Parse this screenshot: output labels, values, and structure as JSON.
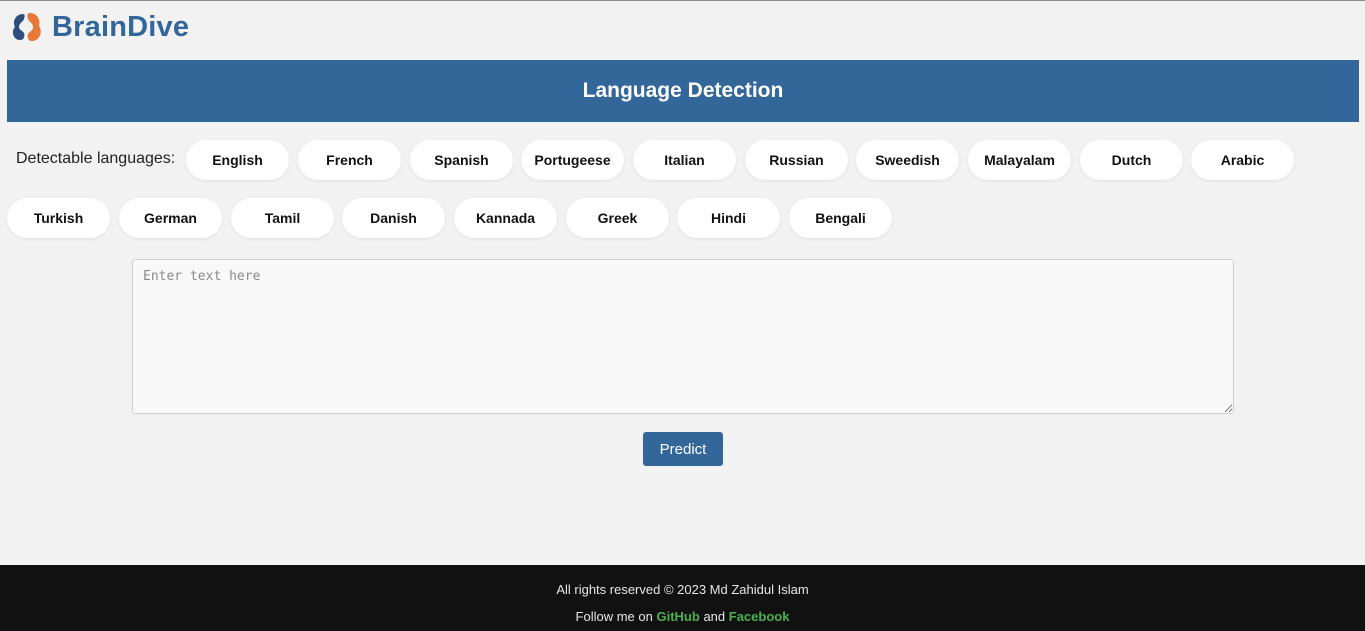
{
  "brand": {
    "name": "BrainDive",
    "colors": {
      "primary": "#336699",
      "accent": "#e8773a"
    }
  },
  "banner": {
    "title": "Language Detection"
  },
  "languages": {
    "label": "Detectable languages:",
    "row1": [
      "English",
      "French",
      "Spanish",
      "Portugeese",
      "Italian",
      "Russian",
      "Sweedish",
      "Malayalam",
      "Dutch",
      "Arabic"
    ],
    "row2": [
      "Turkish",
      "German",
      "Tamil",
      "Danish",
      "Kannada",
      "Greek",
      "Hindi",
      "Bengali"
    ]
  },
  "input": {
    "placeholder": "Enter text here",
    "value": ""
  },
  "predict": {
    "label": "Predict"
  },
  "footer": {
    "copyright": "All rights reserved © 2023 Md Zahidul Islam",
    "follow_prefix": "Follow me on",
    "github": "GitHub",
    "and": "and",
    "facebook": "Facebook",
    "link_color": "#4caf50"
  }
}
